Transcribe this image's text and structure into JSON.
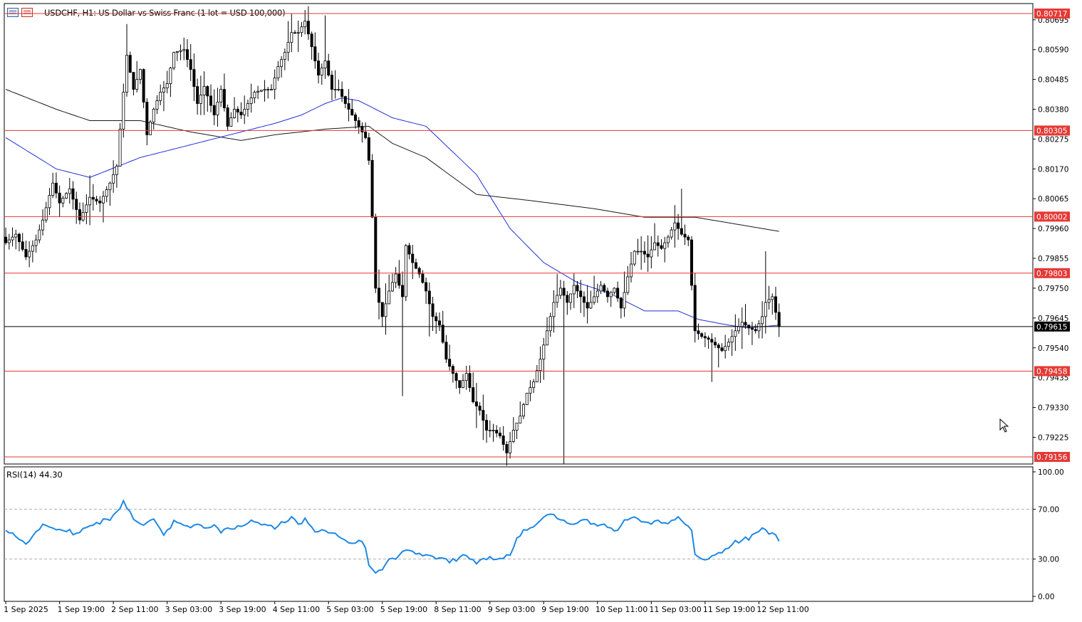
{
  "header": {
    "title": "USDCHF, H1:  US Dollar vs Swiss Franc (1 lot = USD 100,000)",
    "icons": [
      "chart-list-icon",
      "chart-settings-icon"
    ]
  },
  "colors": {
    "candle": "#000000",
    "ma_fast": "#1f2fd6",
    "ma_slow": "#1a1a1a",
    "level_line": "#e53935",
    "level_badge": "#e53935",
    "rsi_line": "#1e88e5",
    "current_price_line": "#000000"
  },
  "chart_data": [
    {
      "type": "candlestick",
      "symbol": "USDCHF",
      "timeframe": "H1",
      "ylim": [
        0.79131,
        0.80732
      ],
      "y_ticks": [
        "0.80695",
        "0.80590",
        "0.80485",
        "0.80380",
        "0.80275",
        "0.80170",
        "0.80065",
        "0.79960",
        "0.79855",
        "0.79750",
        "0.79645",
        "0.79540",
        "0.79435",
        "0.79330",
        "0.79225"
      ],
      "x_ticks": [
        "1 Sep 2025",
        "1 Sep 19:00",
        "2 Sep 11:00",
        "3 Sep 03:00",
        "3 Sep 19:00",
        "4 Sep 11:00",
        "5 Sep 03:00",
        "5 Sep 19:00",
        "8 Sep 11:00",
        "9 Sep 03:00",
        "9 Sep 19:00",
        "10 Sep 11:00",
        "11 Sep 03:00",
        "11 Sep 19:00",
        "12 Sep 11:00"
      ],
      "horizontal_levels": [
        "0.80717",
        "0.80305",
        "0.80002",
        "0.79803",
        "0.79458",
        "0.79156"
      ],
      "current_price": "0.79615",
      "bars_visible": 231,
      "price_anchors": [
        [
          0,
          0.7991
        ],
        [
          3,
          0.7994
        ],
        [
          6,
          0.7986
        ],
        [
          9,
          0.7992
        ],
        [
          11,
          0.7999
        ],
        [
          14,
          0.8012
        ],
        [
          16,
          0.8005
        ],
        [
          19,
          0.801
        ],
        [
          22,
          0.7999
        ],
        [
          25,
          0.8007
        ],
        [
          28,
          0.8005
        ],
        [
          31,
          0.8012
        ],
        [
          33,
          0.8018
        ],
        [
          36,
          0.8057
        ],
        [
          38,
          0.8045
        ],
        [
          40,
          0.8052
        ],
        [
          42,
          0.8029
        ],
        [
          44,
          0.8038
        ],
        [
          46,
          0.8044
        ],
        [
          48,
          0.8047
        ],
        [
          50,
          0.8058
        ],
        [
          53,
          0.8059
        ],
        [
          55,
          0.8052
        ],
        [
          57,
          0.804
        ],
        [
          59,
          0.8046
        ],
        [
          62,
          0.8036
        ],
        [
          64,
          0.8045
        ],
        [
          66,
          0.8032
        ],
        [
          68,
          0.8038
        ],
        [
          70,
          0.8036
        ],
        [
          72,
          0.804
        ],
        [
          74,
          0.8044
        ],
        [
          77,
          0.8045
        ],
        [
          79,
          0.8045
        ],
        [
          81,
          0.8053
        ],
        [
          83,
          0.8058
        ],
        [
          85,
          0.8065
        ],
        [
          87,
          0.8065
        ],
        [
          89,
          0.8069
        ],
        [
          91,
          0.806
        ],
        [
          93,
          0.805
        ],
        [
          95,
          0.8055
        ],
        [
          97,
          0.8045
        ],
        [
          99,
          0.8045
        ],
        [
          101,
          0.804
        ],
        [
          103,
          0.8036
        ],
        [
          105,
          0.8032
        ],
        [
          107,
          0.8028
        ],
        [
          108,
          0.802
        ],
        [
          109,
          0.8
        ],
        [
          110,
          0.7975
        ],
        [
          112,
          0.7965
        ],
        [
          114,
          0.7974
        ],
        [
          116,
          0.798
        ],
        [
          118,
          0.7972
        ],
        [
          119,
          0.799
        ],
        [
          121,
          0.7984
        ],
        [
          123,
          0.798
        ],
        [
          125,
          0.7974
        ],
        [
          127,
          0.7965
        ],
        [
          129,
          0.7962
        ],
        [
          131,
          0.795
        ],
        [
          133,
          0.7945
        ],
        [
          135,
          0.794
        ],
        [
          137,
          0.7945
        ],
        [
          139,
          0.7935
        ],
        [
          141,
          0.7932
        ],
        [
          143,
          0.7925
        ],
        [
          145,
          0.7925
        ],
        [
          147,
          0.7923
        ],
        [
          149,
          0.7917
        ],
        [
          151,
          0.7925
        ],
        [
          153,
          0.793
        ],
        [
          155,
          0.7938
        ],
        [
          157,
          0.7942
        ],
        [
          159,
          0.795
        ],
        [
          161,
          0.796
        ],
        [
          163,
          0.797
        ],
        [
          165,
          0.7975
        ],
        [
          167,
          0.797
        ],
        [
          169,
          0.7976
        ],
        [
          171,
          0.7972
        ],
        [
          173,
          0.7968
        ],
        [
          175,
          0.7972
        ],
        [
          177,
          0.7976
        ],
        [
          179,
          0.7972
        ],
        [
          181,
          0.7975
        ],
        [
          183,
          0.7968
        ],
        [
          185,
          0.7979
        ],
        [
          187,
          0.7988
        ],
        [
          189,
          0.7988
        ],
        [
          191,
          0.7986
        ],
        [
          193,
          0.7991
        ],
        [
          195,
          0.7989
        ],
        [
          197,
          0.7993
        ],
        [
          199,
          0.7998
        ],
        [
          201,
          0.7994
        ],
        [
          203,
          0.7992
        ],
        [
          205,
          0.796
        ],
        [
          207,
          0.7958
        ],
        [
          209,
          0.7957
        ],
        [
          211,
          0.7955
        ],
        [
          213,
          0.7953
        ],
        [
          215,
          0.7956
        ],
        [
          217,
          0.796
        ],
        [
          219,
          0.7963
        ],
        [
          221,
          0.7961
        ],
        [
          223,
          0.796
        ],
        [
          225,
          0.7965
        ],
        [
          226,
          0.797
        ],
        [
          228,
          0.7972
        ],
        [
          230,
          0.7961
        ]
      ],
      "ma_fast_anchors": [
        [
          0,
          0.8028
        ],
        [
          15,
          0.8017
        ],
        [
          25,
          0.8014
        ],
        [
          40,
          0.8021
        ],
        [
          60,
          0.8027
        ],
        [
          80,
          0.8033
        ],
        [
          88,
          0.8036
        ],
        [
          95,
          0.804
        ],
        [
          100,
          0.8042
        ],
        [
          105,
          0.8041
        ],
        [
          115,
          0.8035
        ],
        [
          125,
          0.8032
        ],
        [
          140,
          0.8015
        ],
        [
          150,
          0.7996
        ],
        [
          160,
          0.7984
        ],
        [
          170,
          0.7977
        ],
        [
          180,
          0.7973
        ],
        [
          190,
          0.7967
        ],
        [
          200,
          0.7967
        ],
        [
          206,
          0.7964
        ],
        [
          215,
          0.7962
        ],
        [
          221,
          0.7961
        ],
        [
          230,
          0.7962
        ]
      ],
      "ma_slow_anchors": [
        [
          0,
          0.8045
        ],
        [
          15,
          0.8038
        ],
        [
          25,
          0.8034
        ],
        [
          40,
          0.8034
        ],
        [
          55,
          0.803
        ],
        [
          70,
          0.8027
        ],
        [
          80,
          0.8029
        ],
        [
          95,
          0.8031
        ],
        [
          108,
          0.8032
        ],
        [
          115,
          0.8026
        ],
        [
          125,
          0.8021
        ],
        [
          140,
          0.8008
        ],
        [
          155,
          0.8006
        ],
        [
          175,
          0.8003
        ],
        [
          190,
          0.8
        ],
        [
          205,
          0.8
        ],
        [
          215,
          0.7998
        ],
        [
          230,
          0.7995
        ]
      ]
    },
    {
      "type": "line",
      "indicator": "RSI(14)",
      "label": "RSI(14) 44.30",
      "ylim": [
        0,
        100
      ],
      "y_ticks": [
        "100.00",
        "70.00",
        "30.00",
        "0.00"
      ],
      "reference_levels": [
        70,
        30
      ],
      "last_value": 44.3,
      "rsi_anchors": [
        [
          0,
          53
        ],
        [
          3,
          48
        ],
        [
          6,
          42
        ],
        [
          9,
          52
        ],
        [
          11,
          58
        ],
        [
          14,
          55
        ],
        [
          16,
          52
        ],
        [
          19,
          52
        ],
        [
          22,
          50
        ],
        [
          25,
          58
        ],
        [
          28,
          60
        ],
        [
          31,
          63
        ],
        [
          33,
          68
        ],
        [
          35,
          75
        ],
        [
          37,
          67
        ],
        [
          39,
          60
        ],
        [
          41,
          58
        ],
        [
          44,
          62
        ],
        [
          47,
          50
        ],
        [
          50,
          60
        ],
        [
          53,
          58
        ],
        [
          55,
          55
        ],
        [
          57,
          58
        ],
        [
          60,
          55
        ],
        [
          62,
          58
        ],
        [
          64,
          52
        ],
        [
          66,
          55
        ],
        [
          68,
          56
        ],
        [
          71,
          58
        ],
        [
          74,
          60
        ],
        [
          77,
          58
        ],
        [
          80,
          55
        ],
        [
          82,
          58
        ],
        [
          85,
          62
        ],
        [
          87,
          58
        ],
        [
          89,
          62
        ],
        [
          91,
          55
        ],
        [
          93,
          52
        ],
        [
          95,
          52
        ],
        [
          97,
          50
        ],
        [
          100,
          47
        ],
        [
          102,
          43
        ],
        [
          105,
          45
        ],
        [
          107,
          40
        ],
        [
          108,
          25
        ],
        [
          110,
          20
        ],
        [
          112,
          22
        ],
        [
          114,
          30
        ],
        [
          116,
          28
        ],
        [
          118,
          38
        ],
        [
          120,
          37
        ],
        [
          122,
          35
        ],
        [
          124,
          34
        ],
        [
          126,
          33
        ],
        [
          128,
          30
        ],
        [
          130,
          32
        ],
        [
          132,
          27
        ],
        [
          134,
          30
        ],
        [
          136,
          33
        ],
        [
          138,
          30
        ],
        [
          140,
          28
        ],
        [
          142,
          30
        ],
        [
          144,
          32
        ],
        [
          146,
          29
        ],
        [
          148,
          32
        ],
        [
          150,
          33
        ],
        [
          152,
          45
        ],
        [
          154,
          52
        ],
        [
          156,
          55
        ],
        [
          158,
          60
        ],
        [
          160,
          62
        ],
        [
          162,
          66
        ],
        [
          164,
          63
        ],
        [
          166,
          60
        ],
        [
          168,
          58
        ],
        [
          170,
          60
        ],
        [
          172,
          62
        ],
        [
          174,
          58
        ],
        [
          176,
          58
        ],
        [
          178,
          57
        ],
        [
          180,
          55
        ],
        [
          182,
          54
        ],
        [
          184,
          60
        ],
        [
          186,
          63
        ],
        [
          188,
          62
        ],
        [
          190,
          58
        ],
        [
          192,
          58
        ],
        [
          194,
          60
        ],
        [
          196,
          58
        ],
        [
          198,
          61
        ],
        [
          200,
          62
        ],
        [
          202,
          60
        ],
        [
          204,
          53
        ],
        [
          205,
          32
        ],
        [
          207,
          30
        ],
        [
          209,
          32
        ],
        [
          211,
          33
        ],
        [
          213,
          35
        ],
        [
          215,
          40
        ],
        [
          217,
          43
        ],
        [
          219,
          45
        ],
        [
          221,
          47
        ],
        [
          223,
          52
        ],
        [
          225,
          55
        ],
        [
          227,
          52
        ],
        [
          229,
          50
        ],
        [
          230,
          44.3
        ]
      ]
    }
  ]
}
